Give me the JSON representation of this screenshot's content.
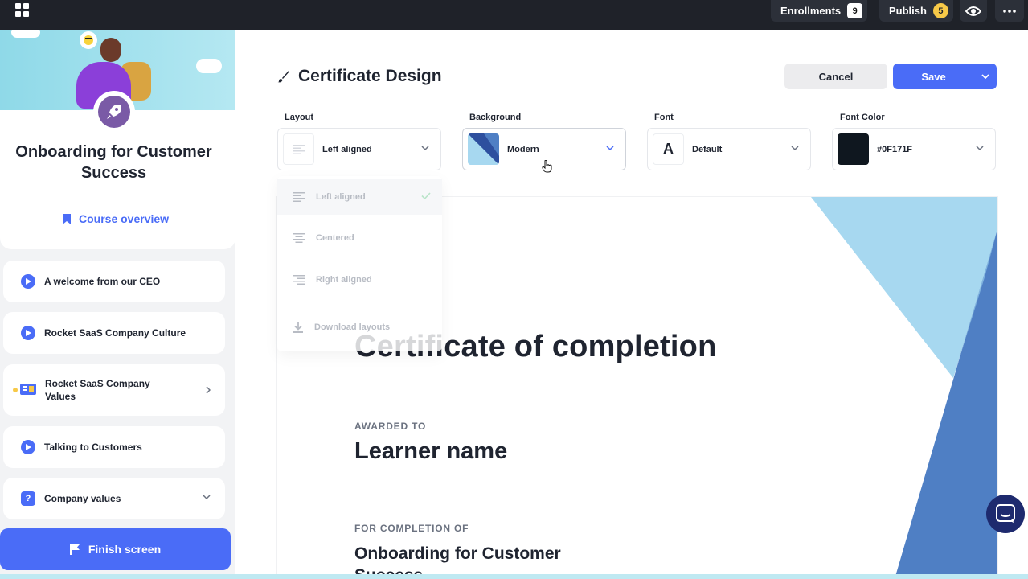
{
  "topbar": {
    "enrollments_label": "Enrollments",
    "enrollments_count": "9",
    "publish_label": "Publish",
    "publish_count": "5"
  },
  "sidebar": {
    "course_title": "Onboarding for Customer Success",
    "overview_label": "Course overview",
    "lessons": [
      {
        "label": "A welcome from our CEO",
        "icon": "play-icon"
      },
      {
        "label": "Rocket SaaS Company Culture",
        "icon": "play-icon"
      },
      {
        "label": "Rocket SaaS Company Values",
        "icon": "slides-icon"
      },
      {
        "label": "Talking to Customers",
        "icon": "play-icon"
      },
      {
        "label": "Company values",
        "icon": "quiz-icon"
      }
    ],
    "finish_label": "Finish screen"
  },
  "editor": {
    "title": "Certificate Design",
    "cancel_label": "Cancel",
    "save_label": "Save",
    "layout": {
      "label": "Layout",
      "value": "Left aligned"
    },
    "background": {
      "label": "Background",
      "value": "Modern"
    },
    "font": {
      "label": "Font",
      "value": "Default",
      "glyph": "A"
    },
    "font_color": {
      "label": "Font Color",
      "value": "#0F171F",
      "swatch": "#0F171F"
    }
  },
  "layout_menu": {
    "items": [
      "Left aligned",
      "Centered",
      "Right aligned",
      "Download layouts"
    ]
  },
  "certificate": {
    "title": "Certificate of completion",
    "awarded_kicker": "AWARDED TO",
    "learner_name": "Learner name",
    "completion_kicker": "FOR COMPLETION OF",
    "course_name": "Onboarding for Customer Success"
  },
  "colors": {
    "accent": "#4A6CF7",
    "topbar": "#1F2229",
    "bg_light_blue": "#A7D8F0",
    "bg_mid_blue": "#4F7FC4"
  }
}
